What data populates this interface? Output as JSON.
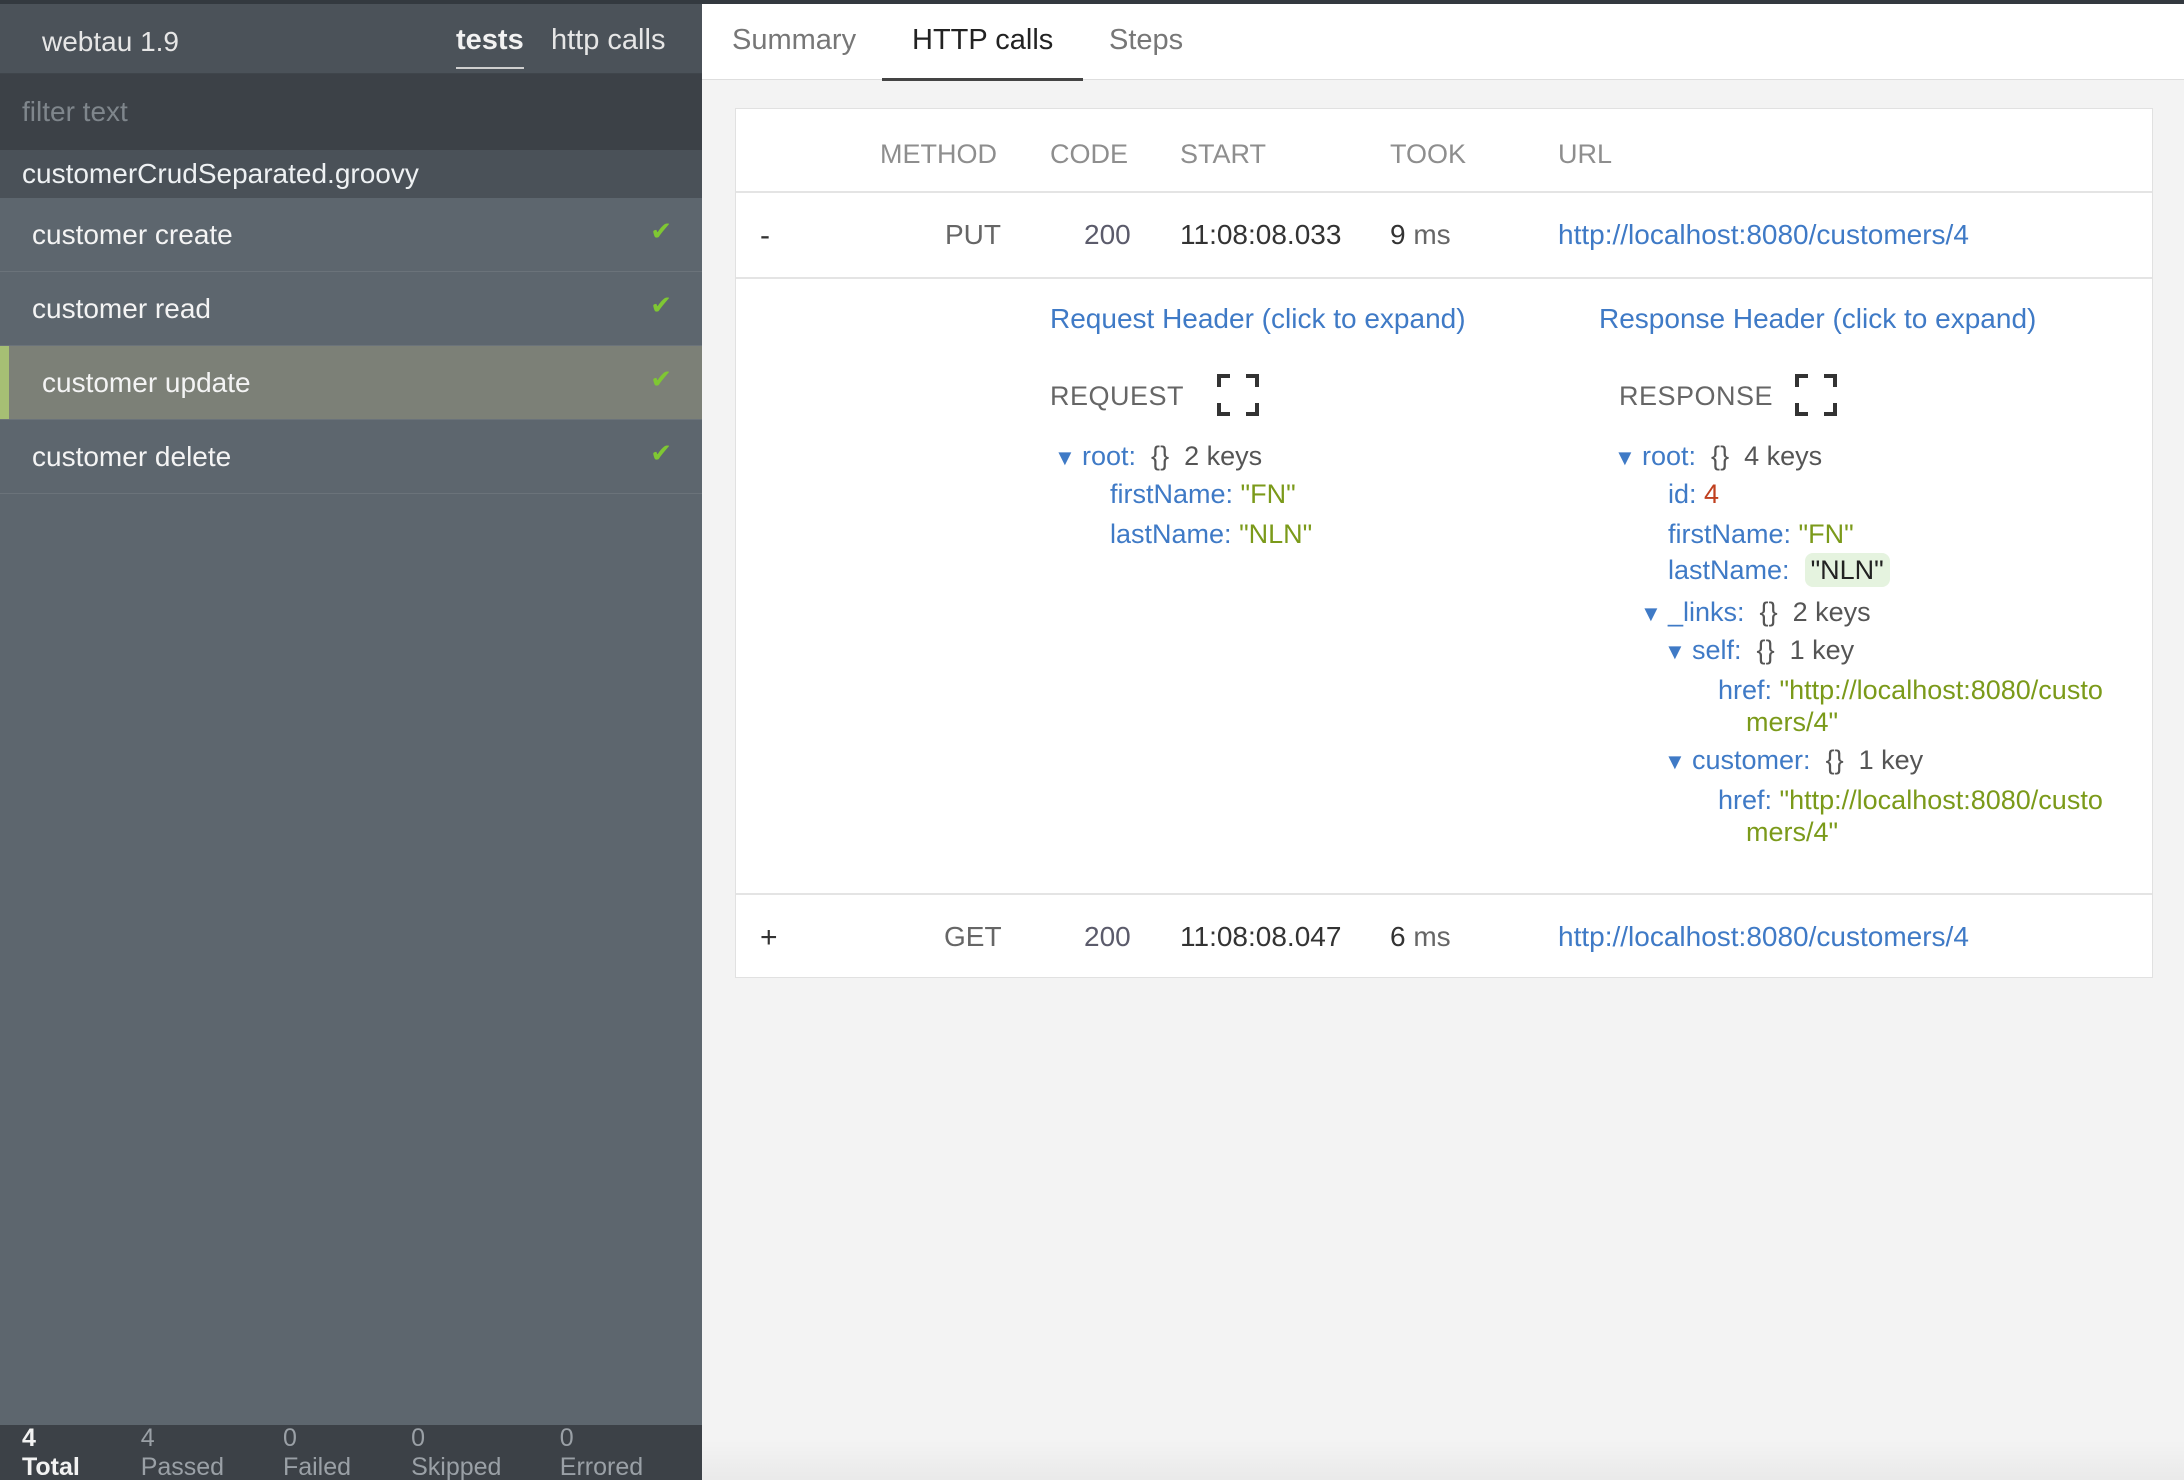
{
  "sidebar": {
    "app_title": "webtau 1.9",
    "tabs": {
      "tests": "tests",
      "http_calls": "http calls"
    },
    "filter_placeholder": "filter text",
    "group_title": "customerCrudSeparated.groovy",
    "tests": [
      {
        "label": "customer create",
        "status": "✔"
      },
      {
        "label": "customer read",
        "status": "✔"
      },
      {
        "label": "customer update",
        "status": "✔"
      },
      {
        "label": "customer delete",
        "status": "✔"
      }
    ],
    "footer": {
      "total": "4 Total",
      "passed": "4 Passed",
      "failed": "0 Failed",
      "skipped": "0 Skipped",
      "errored": "0 Errored"
    }
  },
  "main": {
    "tabs": {
      "summary": "Summary",
      "http_calls": "HTTP calls",
      "steps": "Steps"
    },
    "table": {
      "headers": {
        "method": "METHOD",
        "code": "CODE",
        "start": "START",
        "took": "TOOK",
        "url": "URL"
      },
      "rows": [
        {
          "toggle": "-",
          "method": "PUT",
          "code": "200",
          "start": "11:08:08.033",
          "took": "9",
          "took_unit": "ms",
          "url": "http://localhost:8080/customers/4"
        },
        {
          "toggle": "+",
          "method": "GET",
          "code": "200",
          "start": "11:08:08.047",
          "took": "6",
          "took_unit": "ms",
          "url": "http://localhost:8080/customers/4"
        }
      ]
    },
    "details": {
      "request_header_link": "Request Header (click to expand)",
      "response_header_link": "Response Header (click to expand)",
      "request_label": "REQUEST",
      "response_label": "RESPONSE",
      "request_json": {
        "root_key": "root:",
        "root_meta": "2 keys",
        "firstName_key": "firstName:",
        "firstName_val": "\"FN\"",
        "lastName_key": "lastName:",
        "lastName_val": "\"NLN\""
      },
      "response_json": {
        "root_key": "root:",
        "root_meta": "4 keys",
        "id_key": "id:",
        "id_val": "4",
        "firstName_key": "firstName:",
        "firstName_val": "\"FN\"",
        "lastName_key": "lastName:",
        "lastName_val": "\"NLN\"",
        "links_key": "_links:",
        "links_meta": "2 keys",
        "self_key": "self:",
        "self_meta": "1 key",
        "self_href_key": "href:",
        "self_href_val_1": "\"http://localhost:8080/custo",
        "self_href_val_2": "mers/4\"",
        "customer_key": "customer:",
        "customer_meta": "1 key",
        "customer_href_key": "href:",
        "customer_href_val_1": "\"http://localhost:8080/custo",
        "customer_href_val_2": "mers/4\""
      },
      "brace": "{}"
    }
  },
  "icons": {
    "check": "check-icon",
    "expand": "fullscreen-icon",
    "triangle": "triangle-down-icon"
  },
  "colors": {
    "link": "#3f7ac6",
    "string": "#7b9a1a",
    "number": "#c0401f",
    "pass": "#7fc733",
    "selected_accent": "#a6bf74"
  }
}
